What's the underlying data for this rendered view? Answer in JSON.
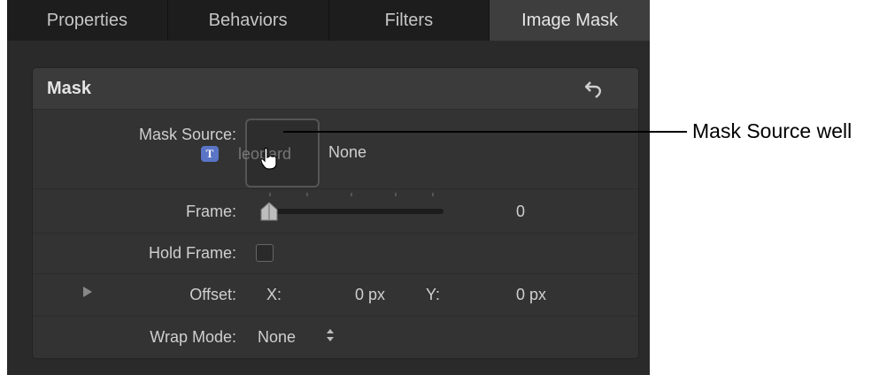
{
  "tabs": [
    {
      "label": "Properties",
      "active": false
    },
    {
      "label": "Behaviors",
      "active": false
    },
    {
      "label": "Filters",
      "active": false
    },
    {
      "label": "Image Mask",
      "active": true
    }
  ],
  "panel": {
    "title": "Mask",
    "reset_icon": "reset-arrow-icon"
  },
  "mask_source": {
    "label": "Mask Source:",
    "value": "None",
    "dragged_item_name": "leopard",
    "dragged_item_icon": "text-layer-icon",
    "dragged_item_icon_glyph": "T"
  },
  "frame": {
    "label": "Frame:",
    "value": "0"
  },
  "hold_frame": {
    "label": "Hold Frame:",
    "checked": false
  },
  "offset": {
    "label": "Offset:",
    "x_label": "X:",
    "x_value": "0 px",
    "y_label": "Y:",
    "y_value": "0 px"
  },
  "wrap_mode": {
    "label": "Wrap Mode:",
    "value": "None"
  },
  "callout": {
    "text": "Mask Source well"
  },
  "colors": {
    "window_bg": "#2a2a2a",
    "tab_active": "#3e3e3e",
    "text_icon_accent": "#5a74c6"
  }
}
